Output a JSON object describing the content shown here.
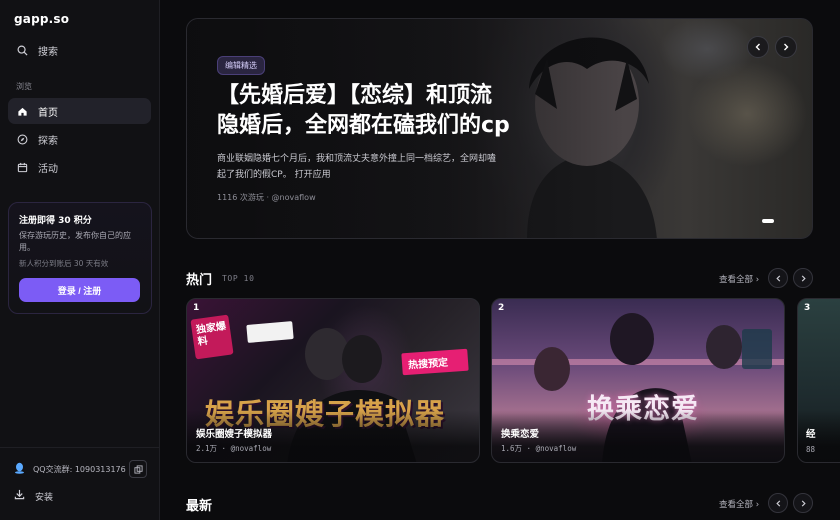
{
  "sidebar": {
    "brand": "gapp.so",
    "search_label": "搜索",
    "section_label": "浏览",
    "nav": [
      {
        "label": "首页",
        "icon": "home-icon",
        "active": true
      },
      {
        "label": "探索",
        "icon": "compass-icon",
        "active": false
      },
      {
        "label": "活动",
        "icon": "calendar-icon",
        "active": false
      }
    ],
    "promo": {
      "title": "注册即得 30 积分",
      "desc": "保存游玩历史，发布你自己的应用。",
      "note": "新人积分到账后 30 天有效",
      "button": "登录 / 注册"
    },
    "qq_label": "QQ交流群: 1090313176",
    "install_label": "安装"
  },
  "hero": {
    "badge": "编辑精选",
    "title_line1": "【先婚后爱】【恋综】和顶流",
    "title_line2": "隐婚后，全网都在磕我们的cp",
    "desc": "商业联姻隐婚七个月后，我和顶流丈夫意外撞上同一档综艺，全网却嗑起了我们的假CP。 打开应用",
    "meta": "1116 次游玩 · @novaflow"
  },
  "hot": {
    "title": "热门",
    "subtitle": "TOP 10",
    "view_all": "查看全部 ›",
    "cards": [
      {
        "rank": "1",
        "title": "娱乐圈嫂子模拟器",
        "meta": "2.1万 · @novaflow",
        "art_text": "娱乐圈嫂子模拟器",
        "art_tag": "热搜预定",
        "art_tag2": "独家爆料"
      },
      {
        "rank": "2",
        "title": "换乘恋爱",
        "meta": "1.6万 · @novaflow",
        "art_text": "换乘恋爱"
      },
      {
        "rank": "3",
        "title": "经",
        "meta": "88"
      }
    ]
  },
  "latest": {
    "title": "最新",
    "view_all": "查看全部 ›"
  }
}
